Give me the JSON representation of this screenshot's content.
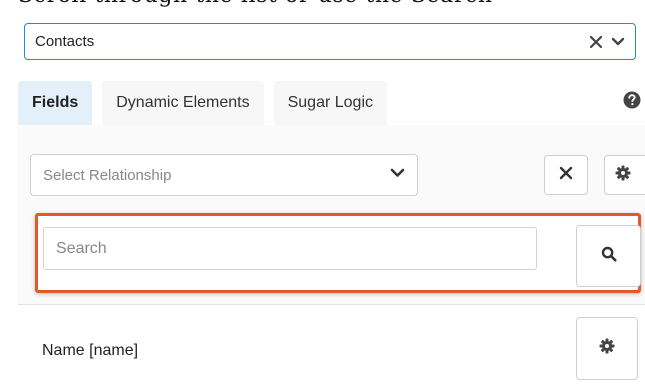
{
  "doc_caption": "Scroll through the list or use the Search",
  "module_select": {
    "value": "Contacts",
    "clear_icon": "close-icon",
    "toggle_icon": "chevron-down-icon"
  },
  "tabs": [
    {
      "label": "Fields",
      "active": true
    },
    {
      "label": "Dynamic Elements",
      "active": false
    },
    {
      "label": "Sugar Logic",
      "active": false
    }
  ],
  "help_icon": "question-circle-icon",
  "relationship_select": {
    "placeholder": "Select Relationship",
    "toggle_icon": "chevron-down-icon"
  },
  "relationship_actions": {
    "clear_icon": "close-icon",
    "settings_icon": "gear-icon"
  },
  "search": {
    "placeholder": "Search",
    "value": "",
    "button_icon": "search-icon",
    "highlight_color": "#e05a2b"
  },
  "fields": [
    {
      "label": "Name [name]",
      "settings_icon": "gear-icon"
    }
  ],
  "colors": {
    "focus_border": "#2e84d6",
    "active_tab_bg": "#e3eff9",
    "icon": "#444444"
  }
}
